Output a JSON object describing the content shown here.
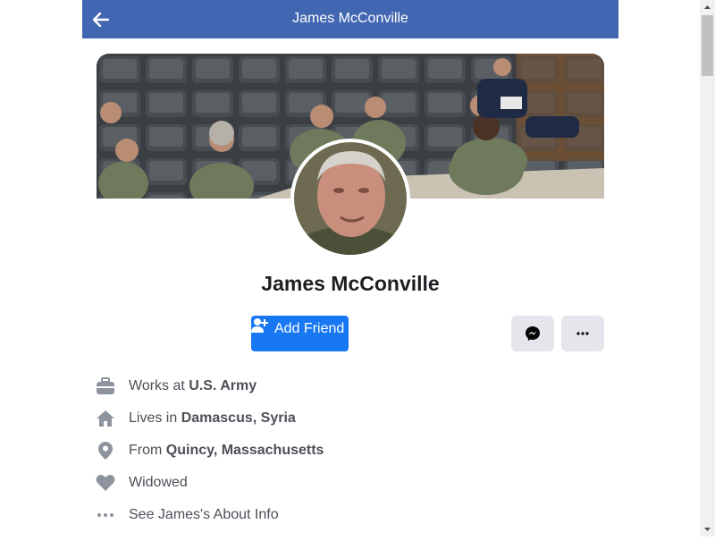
{
  "header": {
    "title": "James McConville",
    "back_icon": "arrow-left-icon",
    "background": "#4267b2"
  },
  "profile": {
    "name": "James McConville",
    "cover_image": "photo of uniformed officers seated in an auditorium",
    "avatar_image": "portrait of a grey-haired man in military uniform"
  },
  "actions": {
    "add_friend_label": "Add Friend",
    "add_friend_icon": "add-person-icon",
    "messenger_icon": "messenger-icon",
    "more_icon": "more-dots-icon",
    "primary_color": "#1877f2",
    "secondary_color": "#e4e6eb"
  },
  "info": {
    "work": {
      "prefix": "Works at ",
      "value": "U.S. Army",
      "icon": "briefcase-icon"
    },
    "lives": {
      "prefix": "Lives in ",
      "value": "Damascus, Syria",
      "icon": "home-icon"
    },
    "from": {
      "prefix": "From ",
      "value": "Quincy, Massachusetts",
      "icon": "location-pin-icon"
    },
    "relationship": {
      "text": "Widowed",
      "icon": "heart-icon"
    },
    "about": {
      "text": "See James's About Info",
      "icon": "more-dots-icon"
    }
  }
}
